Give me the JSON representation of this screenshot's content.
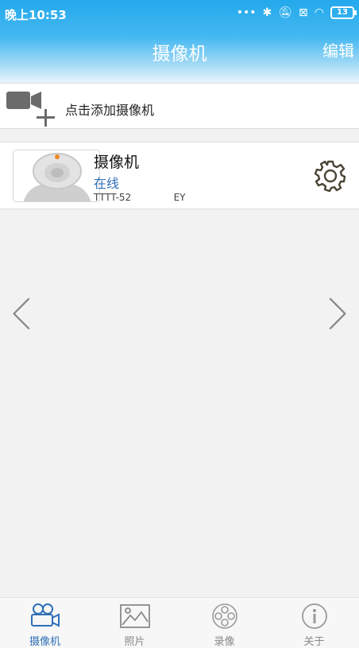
{
  "status_bar": {
    "time": "晚上10:53",
    "battery": "13"
  },
  "header": {
    "title": "摄像机",
    "edit_label": "编辑"
  },
  "add_camera": {
    "label": "点击添加摄像机"
  },
  "camera": {
    "name": "摄像机",
    "status": "在线",
    "uid": "TTTT-52              EY"
  },
  "tabs": [
    {
      "label": "摄像机",
      "icon": "camera-icon",
      "active": true
    },
    {
      "label": "照片",
      "icon": "photo-icon",
      "active": false
    },
    {
      "label": "录像",
      "icon": "film-reel-icon",
      "active": false
    },
    {
      "label": "关于",
      "icon": "info-icon",
      "active": false
    }
  ],
  "colors": {
    "header_top": "#23a9ec",
    "accent": "#2f6fb7",
    "background": "#f2f2f2"
  }
}
